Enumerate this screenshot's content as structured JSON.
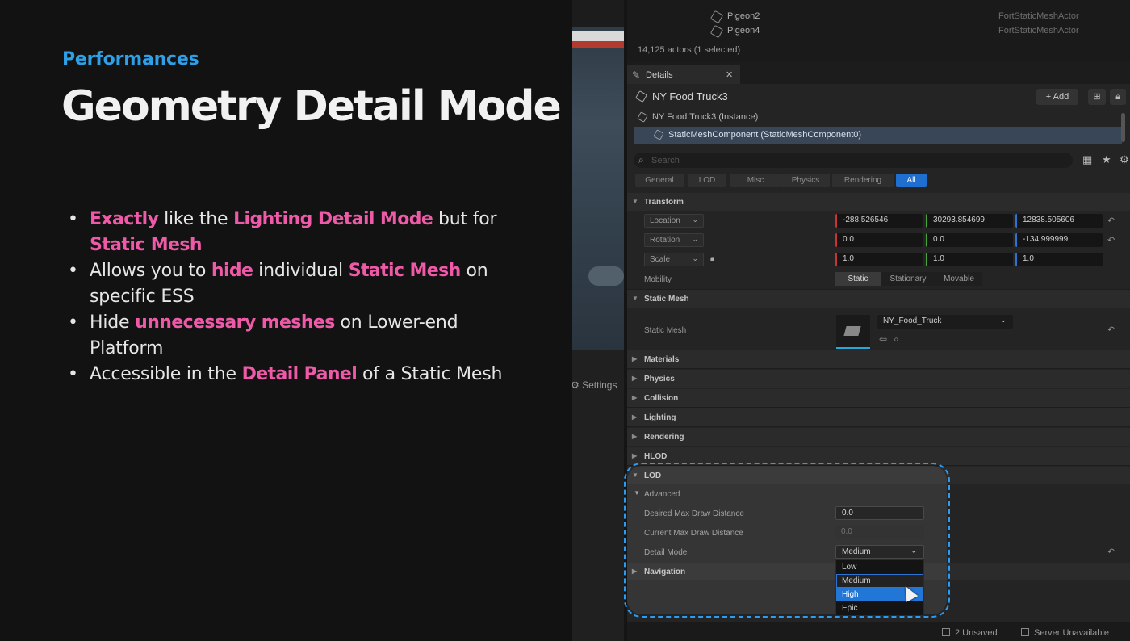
{
  "slide": {
    "eyebrow": "Performances",
    "title": "Geometry Detail Mode",
    "bullets": [
      {
        "segments": [
          {
            "text": "Exactly",
            "highlight": true
          },
          {
            "text": " like the ",
            "highlight": false
          },
          {
            "text": "Lighting Detail Mode",
            "highlight": true
          },
          {
            "text": " but for ",
            "highlight": false
          },
          {
            "text": "Static Mesh",
            "highlight": true
          }
        ]
      },
      {
        "segments": [
          {
            "text": "Allows you to ",
            "highlight": false
          },
          {
            "text": "hide",
            "highlight": true
          },
          {
            "text": " individual ",
            "highlight": false
          },
          {
            "text": "Static Mesh",
            "highlight": true
          },
          {
            "text": " on specific ESS",
            "highlight": false
          }
        ]
      },
      {
        "segments": [
          {
            "text": "Hide ",
            "highlight": false
          },
          {
            "text": "unnecessary meshes",
            "highlight": true
          },
          {
            "text": " on Lower-end Platform",
            "highlight": false
          }
        ]
      },
      {
        "segments": [
          {
            "text": "Accessible in the ",
            "highlight": false
          },
          {
            "text": "Detail Panel",
            "highlight": true
          },
          {
            "text": " of a Static Mesh",
            "highlight": false
          }
        ]
      }
    ],
    "colors": {
      "accent_blue": "#2f9fe6",
      "highlight_pink": "#ee5aa8"
    }
  },
  "editor": {
    "viewport_settings_label": "Settings",
    "outliner": {
      "rows": [
        {
          "name": "Pigeon2",
          "type": "FortStaticMeshActor",
          "icon": "cube-icon"
        },
        {
          "name": "Pigeon4",
          "type": "FortStaticMeshActor",
          "icon": "cube-icon"
        }
      ],
      "count": "14,125 actors (1 selected)"
    },
    "details": {
      "tab_label": "Details",
      "actor_name": "NY Food Truck3",
      "add_label": "Add",
      "components": [
        {
          "name": "NY Food Truck3 (Instance)",
          "selected": false
        },
        {
          "name": "StaticMeshComponent (StaticMeshComponent0)",
          "selected": true
        }
      ],
      "search_placeholder": "Search",
      "filters": [
        {
          "label": "General",
          "active": false
        },
        {
          "label": "LOD",
          "active": false
        },
        {
          "label": "Misc",
          "active": false
        },
        {
          "label": "Physics",
          "active": false
        },
        {
          "label": "Rendering",
          "active": false
        },
        {
          "label": "All",
          "active": true
        }
      ],
      "transform": {
        "section": "Transform",
        "location_label": "Location",
        "location": [
          "-288.526546",
          "30293.854699",
          "12838.505606"
        ],
        "rotation_label": "Rotation",
        "rotation": [
          "0.0",
          "0.0",
          "-134.999999"
        ],
        "scale_label": "Scale",
        "scale": [
          "1.0",
          "1.0",
          "1.0"
        ],
        "mobility_label": "Mobility",
        "mobility_options": [
          "Static",
          "Stationary",
          "Movable"
        ],
        "mobility_selected": "Static"
      },
      "static_mesh": {
        "section": "Static Mesh",
        "label": "Static Mesh",
        "value": "NY_Food_Truck"
      },
      "collapsed_sections": [
        "Materials",
        "Physics",
        "Collision",
        "Lighting",
        "Rendering",
        "HLOD"
      ],
      "lod": {
        "section": "LOD",
        "advanced": "Advanced",
        "desired_label": "Desired Max Draw Distance",
        "desired_value": "0.0",
        "current_label": "Current Max Draw Distance",
        "current_value": "0.0",
        "detail_mode_label": "Detail Mode",
        "detail_mode_value": "Medium",
        "options": [
          "Low",
          "Medium",
          "High",
          "Epic"
        ],
        "hovered_option": "Medium",
        "highlighted_option": "High"
      },
      "navigation": "Navigation"
    },
    "status": {
      "unsaved": "2 Unsaved",
      "server": "Server Unavailable"
    },
    "colors": {
      "selection_blue": "#2176d6",
      "dashed_highlight": "#2d9bf0"
    }
  }
}
